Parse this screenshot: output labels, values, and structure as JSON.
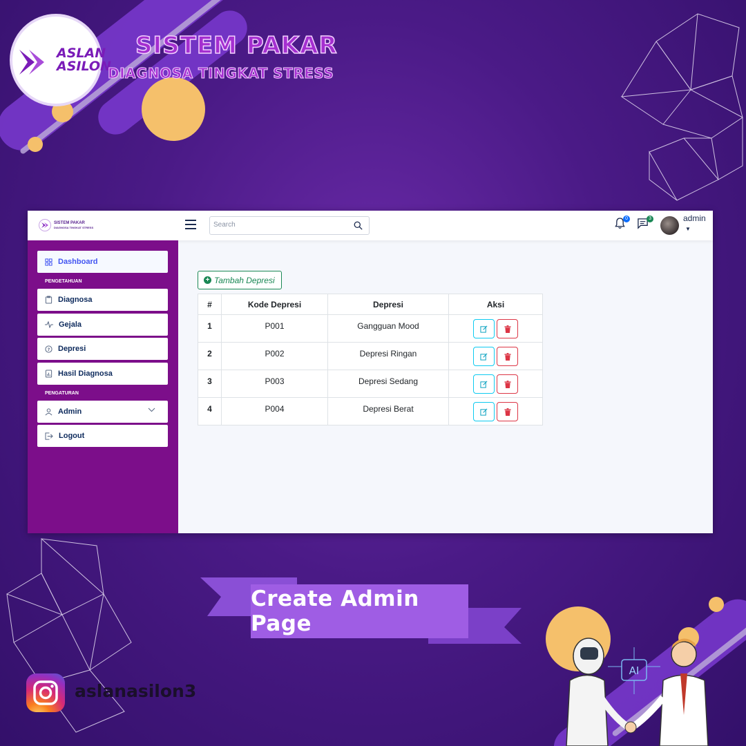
{
  "brand": {
    "logo_line1": "ASLAN",
    "logo_line2": "ASILON",
    "title": "SISTEM PAKAR",
    "subtitle": "DIAGNOSA TINGKAT STRESS"
  },
  "topbar": {
    "mini_logo_title": "SISTEM PAKAR",
    "mini_logo_sub": "DIAGNOSA TINGKAT STRESS",
    "search_placeholder": "Search",
    "notifications_count": "0",
    "messages_count": "3",
    "user_name": "admin",
    "notification_badge_color": "#0d6efd",
    "message_badge_color": "#198754"
  },
  "sidebar": {
    "section_knowledge": "PENGETAHUAN",
    "section_settings": "PENGATURAN",
    "items": [
      {
        "label": "Dashboard",
        "icon": "grid-icon"
      },
      {
        "label": "Diagnosa",
        "icon": "clipboard-icon"
      },
      {
        "label": "Gejala",
        "icon": "activity-icon"
      },
      {
        "label": "Depresi",
        "icon": "question-circle-icon"
      },
      {
        "label": "Hasil Diagnosa",
        "icon": "bar-chart-icon"
      },
      {
        "label": "Admin",
        "icon": "person-icon"
      },
      {
        "label": "Logout",
        "icon": "box-arrow-right-icon"
      }
    ],
    "color": "#7c0e8a"
  },
  "main": {
    "add_button": "Tambah Depresi",
    "table": {
      "headers": [
        "#",
        "Kode Depresi",
        "Depresi",
        "Aksi"
      ],
      "rows": [
        {
          "no": "1",
          "kode": "P001",
          "depresi": "Gangguan Mood"
        },
        {
          "no": "2",
          "kode": "P002",
          "depresi": "Depresi Ringan"
        },
        {
          "no": "3",
          "kode": "P003",
          "depresi": "Depresi Sedang"
        },
        {
          "no": "4",
          "kode": "P004",
          "depresi": "Depresi Berat"
        }
      ]
    }
  },
  "footer": {
    "cta": "Create Admin Page",
    "instagram_handle": "aslanasilon3",
    "illustration_label": "AI"
  }
}
